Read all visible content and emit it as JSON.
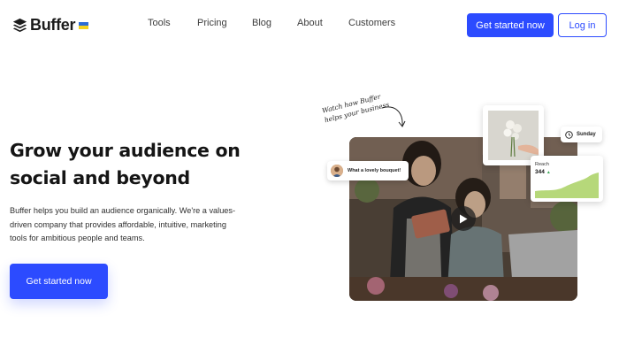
{
  "brand": {
    "name": "Buffer",
    "logo_icon": "buffer-stack-icon",
    "flag_icon": "ukraine-flag-icon",
    "flag_colors": [
      "#2b6bd6",
      "#f4d21f"
    ]
  },
  "nav": {
    "items": [
      {
        "label": "Tools"
      },
      {
        "label": "Pricing"
      },
      {
        "label": "Blog"
      },
      {
        "label": "About"
      },
      {
        "label": "Customers"
      }
    ],
    "cta_label": "Get started now",
    "login_label": "Log in"
  },
  "hero": {
    "title": "Grow your audience on social and beyond",
    "description": "Buffer helps you build an audience organically. We're a values-driven company that provides affordable, intuitive, marketing tools for ambitious people and teams.",
    "cta_label": "Get started now"
  },
  "video": {
    "handwritten_note": "Watch how Buffer helps your business",
    "comment_text": "What a lovely bouquet!",
    "day_label": "Sunday",
    "reach_label": "Reach",
    "reach_value": "344",
    "reach_trend": "▲",
    "play_icon": "play-icon",
    "clock_icon": "clock-icon"
  },
  "colors": {
    "accent": "#2c4bff",
    "text": "#1c1c1c",
    "chart_fill": "#b6d87a"
  }
}
